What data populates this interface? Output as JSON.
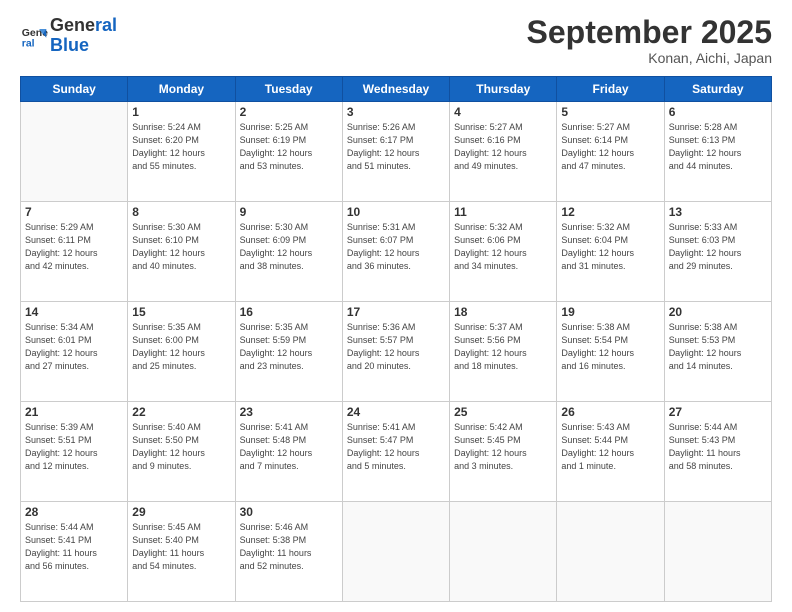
{
  "header": {
    "logo_line1": "General",
    "logo_line2": "Blue",
    "month": "September 2025",
    "location": "Konan, Aichi, Japan"
  },
  "weekdays": [
    "Sunday",
    "Monday",
    "Tuesday",
    "Wednesday",
    "Thursday",
    "Friday",
    "Saturday"
  ],
  "weeks": [
    [
      {
        "day": "",
        "info": ""
      },
      {
        "day": "1",
        "info": "Sunrise: 5:24 AM\nSunset: 6:20 PM\nDaylight: 12 hours\nand 55 minutes."
      },
      {
        "day": "2",
        "info": "Sunrise: 5:25 AM\nSunset: 6:19 PM\nDaylight: 12 hours\nand 53 minutes."
      },
      {
        "day": "3",
        "info": "Sunrise: 5:26 AM\nSunset: 6:17 PM\nDaylight: 12 hours\nand 51 minutes."
      },
      {
        "day": "4",
        "info": "Sunrise: 5:27 AM\nSunset: 6:16 PM\nDaylight: 12 hours\nand 49 minutes."
      },
      {
        "day": "5",
        "info": "Sunrise: 5:27 AM\nSunset: 6:14 PM\nDaylight: 12 hours\nand 47 minutes."
      },
      {
        "day": "6",
        "info": "Sunrise: 5:28 AM\nSunset: 6:13 PM\nDaylight: 12 hours\nand 44 minutes."
      }
    ],
    [
      {
        "day": "7",
        "info": "Sunrise: 5:29 AM\nSunset: 6:11 PM\nDaylight: 12 hours\nand 42 minutes."
      },
      {
        "day": "8",
        "info": "Sunrise: 5:30 AM\nSunset: 6:10 PM\nDaylight: 12 hours\nand 40 minutes."
      },
      {
        "day": "9",
        "info": "Sunrise: 5:30 AM\nSunset: 6:09 PM\nDaylight: 12 hours\nand 38 minutes."
      },
      {
        "day": "10",
        "info": "Sunrise: 5:31 AM\nSunset: 6:07 PM\nDaylight: 12 hours\nand 36 minutes."
      },
      {
        "day": "11",
        "info": "Sunrise: 5:32 AM\nSunset: 6:06 PM\nDaylight: 12 hours\nand 34 minutes."
      },
      {
        "day": "12",
        "info": "Sunrise: 5:32 AM\nSunset: 6:04 PM\nDaylight: 12 hours\nand 31 minutes."
      },
      {
        "day": "13",
        "info": "Sunrise: 5:33 AM\nSunset: 6:03 PM\nDaylight: 12 hours\nand 29 minutes."
      }
    ],
    [
      {
        "day": "14",
        "info": "Sunrise: 5:34 AM\nSunset: 6:01 PM\nDaylight: 12 hours\nand 27 minutes."
      },
      {
        "day": "15",
        "info": "Sunrise: 5:35 AM\nSunset: 6:00 PM\nDaylight: 12 hours\nand 25 minutes."
      },
      {
        "day": "16",
        "info": "Sunrise: 5:35 AM\nSunset: 5:59 PM\nDaylight: 12 hours\nand 23 minutes."
      },
      {
        "day": "17",
        "info": "Sunrise: 5:36 AM\nSunset: 5:57 PM\nDaylight: 12 hours\nand 20 minutes."
      },
      {
        "day": "18",
        "info": "Sunrise: 5:37 AM\nSunset: 5:56 PM\nDaylight: 12 hours\nand 18 minutes."
      },
      {
        "day": "19",
        "info": "Sunrise: 5:38 AM\nSunset: 5:54 PM\nDaylight: 12 hours\nand 16 minutes."
      },
      {
        "day": "20",
        "info": "Sunrise: 5:38 AM\nSunset: 5:53 PM\nDaylight: 12 hours\nand 14 minutes."
      }
    ],
    [
      {
        "day": "21",
        "info": "Sunrise: 5:39 AM\nSunset: 5:51 PM\nDaylight: 12 hours\nand 12 minutes."
      },
      {
        "day": "22",
        "info": "Sunrise: 5:40 AM\nSunset: 5:50 PM\nDaylight: 12 hours\nand 9 minutes."
      },
      {
        "day": "23",
        "info": "Sunrise: 5:41 AM\nSunset: 5:48 PM\nDaylight: 12 hours\nand 7 minutes."
      },
      {
        "day": "24",
        "info": "Sunrise: 5:41 AM\nSunset: 5:47 PM\nDaylight: 12 hours\nand 5 minutes."
      },
      {
        "day": "25",
        "info": "Sunrise: 5:42 AM\nSunset: 5:45 PM\nDaylight: 12 hours\nand 3 minutes."
      },
      {
        "day": "26",
        "info": "Sunrise: 5:43 AM\nSunset: 5:44 PM\nDaylight: 12 hours\nand 1 minute."
      },
      {
        "day": "27",
        "info": "Sunrise: 5:44 AM\nSunset: 5:43 PM\nDaylight: 11 hours\nand 58 minutes."
      }
    ],
    [
      {
        "day": "28",
        "info": "Sunrise: 5:44 AM\nSunset: 5:41 PM\nDaylight: 11 hours\nand 56 minutes."
      },
      {
        "day": "29",
        "info": "Sunrise: 5:45 AM\nSunset: 5:40 PM\nDaylight: 11 hours\nand 54 minutes."
      },
      {
        "day": "30",
        "info": "Sunrise: 5:46 AM\nSunset: 5:38 PM\nDaylight: 11 hours\nand 52 minutes."
      },
      {
        "day": "",
        "info": ""
      },
      {
        "day": "",
        "info": ""
      },
      {
        "day": "",
        "info": ""
      },
      {
        "day": "",
        "info": ""
      }
    ]
  ]
}
